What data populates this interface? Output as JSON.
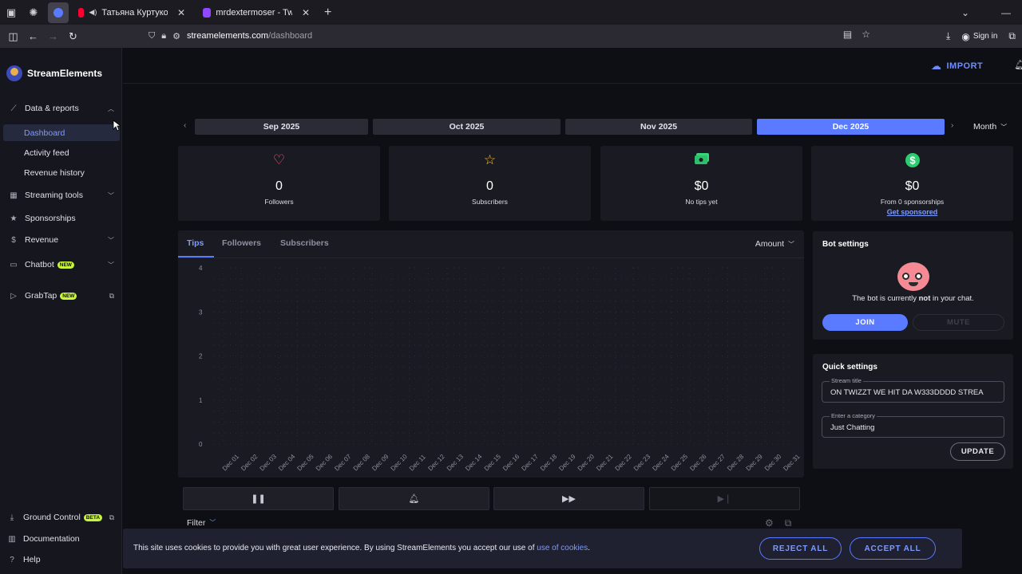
{
  "browser": {
    "tabs": [
      {
        "label": "Татьяна Куртукова - Два б",
        "color": "#ff0033"
      },
      {
        "label": "mrdextermoser - Twitch",
        "color": "#9146ff"
      }
    ],
    "url_domain": "streamelements.com",
    "url_path": "/dashboard",
    "sign_in": "Sign in"
  },
  "sidebar": {
    "brand": "StreamElements",
    "sections": [
      {
        "label": "Data & reports",
        "icon": "chart-line-icon"
      },
      {
        "label": "Streaming tools",
        "icon": "grid-icon"
      },
      {
        "label": "Sponsorships",
        "icon": "star-icon"
      },
      {
        "label": "Revenue",
        "icon": "dollar-icon"
      },
      {
        "label": "Chatbot",
        "icon": "chat-icon",
        "badge": "NEW"
      },
      {
        "label": "GrabTap",
        "icon": "play-icon",
        "badge": "NEW"
      }
    ],
    "sub_items": [
      {
        "label": "Dashboard",
        "active": true
      },
      {
        "label": "Activity feed"
      },
      {
        "label": "Revenue history"
      }
    ],
    "footer": [
      {
        "label": "Ground Control",
        "badge": "BETA"
      },
      {
        "label": "Documentation"
      },
      {
        "label": "Help"
      }
    ]
  },
  "topbar": {
    "import": "IMPORT"
  },
  "months": [
    "Sep 2025",
    "Oct 2025",
    "Nov 2025",
    "Dec 2025"
  ],
  "active_month": "Dec 2025",
  "period": "Month",
  "stats": [
    {
      "value": "0",
      "label": "Followers",
      "icon": "heart-icon",
      "color": "#ff5a7a"
    },
    {
      "value": "0",
      "label": "Subscribers",
      "icon": "star-icon",
      "color": "#ffc13b"
    },
    {
      "value": "$0",
      "label": "No tips yet",
      "icon": "cash-icon",
      "color": "#3ad27a"
    },
    {
      "value": "$0",
      "label": "From 0 sponsorships",
      "icon": "dollar-circle-icon",
      "color": "#2ecc71",
      "link": "Get sponsored"
    }
  ],
  "chart_tabs": [
    "Tips",
    "Followers",
    "Subscribers"
  ],
  "chart_dropdown": "Amount",
  "chart_data": {
    "type": "line",
    "x": [
      "Dec 01",
      "Dec 02",
      "Dec 03",
      "Dec 04",
      "Dec 05",
      "Dec 06",
      "Dec 07",
      "Dec 08",
      "Dec 09",
      "Dec 10",
      "Dec 11",
      "Dec 12",
      "Dec 13",
      "Dec 14",
      "Dec 15",
      "Dec 16",
      "Dec 17",
      "Dec 18",
      "Dec 19",
      "Dec 20",
      "Dec 21",
      "Dec 22",
      "Dec 23",
      "Dec 24",
      "Dec 25",
      "Dec 26",
      "Dec 27",
      "Dec 28",
      "Dec 29",
      "Dec 30",
      "Dec 31"
    ],
    "y_ticks": [
      "0",
      "1",
      "2",
      "3",
      "4"
    ],
    "ylim": [
      0,
      4
    ],
    "series": [],
    "grid": true
  },
  "filter": "Filter",
  "bot": {
    "title": "Bot settings",
    "status_pre": "The bot is currently ",
    "status_bold": "not",
    "status_post": " in your chat.",
    "join": "JOIN",
    "mute": "MUTE"
  },
  "quick": {
    "title": "Quick settings",
    "stream_title_label": "Stream title",
    "stream_title_value": "ON TWIZZT WE HIT DA W333DDDD STREA",
    "category_label": "Enter a category",
    "category_value": "Just Chatting",
    "update": "UPDATE"
  },
  "cookie": {
    "message": "This site uses cookies to provide you with great user experience. By using StreamElements you accept our use of ",
    "link": "use of cookies",
    "reject": "REJECT ALL",
    "accept": "ACCEPT ALL"
  }
}
